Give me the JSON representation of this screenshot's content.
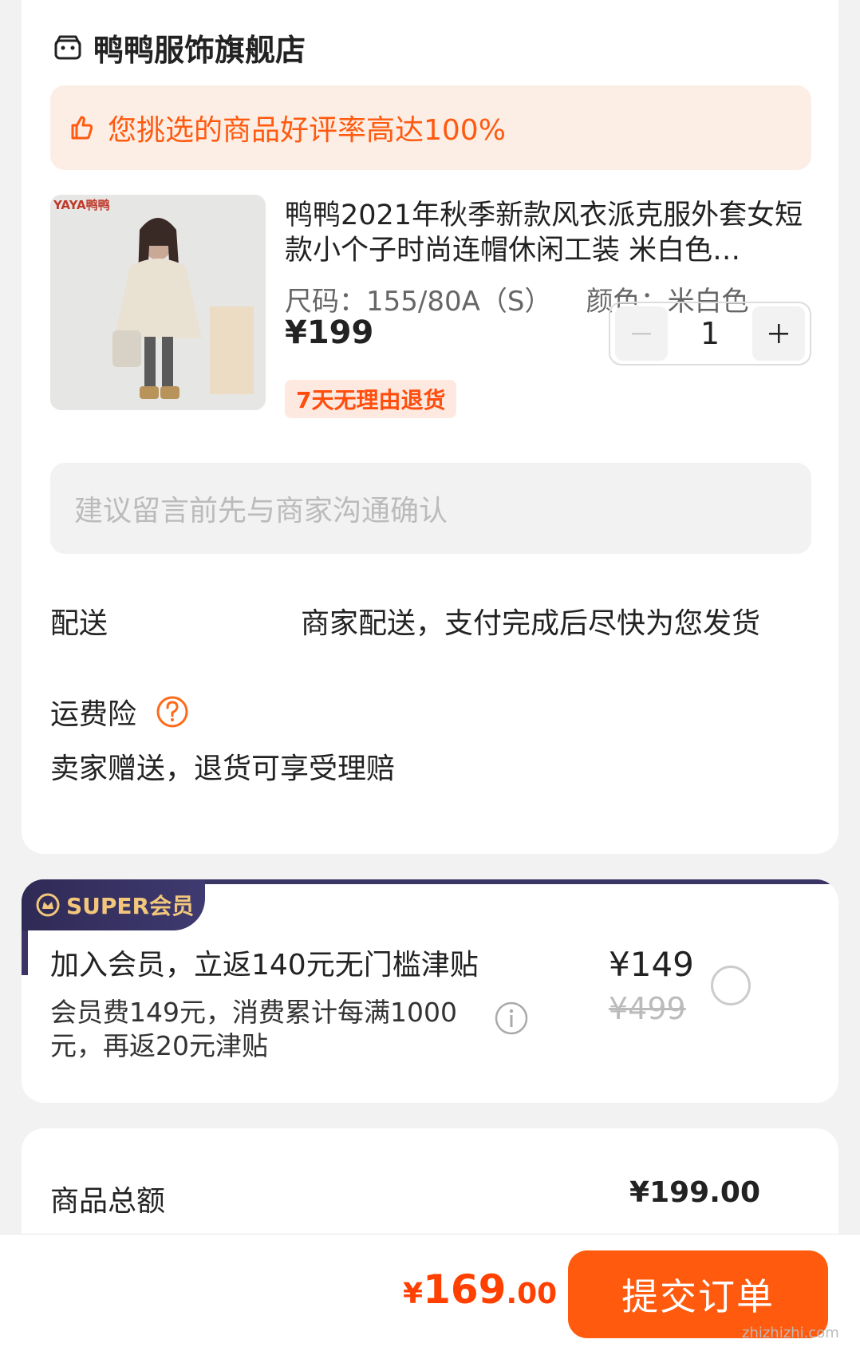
{
  "store": {
    "name": "鸭鸭服饰旗舰店",
    "rating_banner": "您挑选的商品好评率高达100%"
  },
  "product": {
    "image_logo_text": "YAYA鸭鸭",
    "title": "鸭鸭2021年秋季新款风衣派克服外套女短款小个子时尚连帽休闲工装 米白色…",
    "spec": "尺码：155/80A（S）    颜色：米白色",
    "price": "¥199",
    "quantity": "1",
    "return_badge": "7天无理由退货"
  },
  "message": {
    "placeholder": "建议留言前先与商家沟通确认"
  },
  "delivery": {
    "label": "配送",
    "value": "商家配送，支付完成后尽快为您发货"
  },
  "insurance": {
    "label": "运费险",
    "desc": "卖家赠送，退货可享受理赔"
  },
  "super_member": {
    "badge": "SUPER会员",
    "title": "加入会员，立返140元无门槛津贴",
    "desc": "会员费149元，消费累计每满1000元，再返20元津贴",
    "price": "¥149",
    "old_price": "¥499"
  },
  "summary": {
    "total_label": "商品总额",
    "total_value": "¥199.00"
  },
  "footer": {
    "currency": "¥",
    "amount_int": "169",
    "amount_dec": ".00",
    "submit_label": "提交订单",
    "watermark": "zhizhizhi.com"
  },
  "colors": {
    "accent": "#ff5a0d",
    "banner_bg": "#fdeee5",
    "super_dark": "#3b3566",
    "super_gold": "#f2c77b"
  }
}
